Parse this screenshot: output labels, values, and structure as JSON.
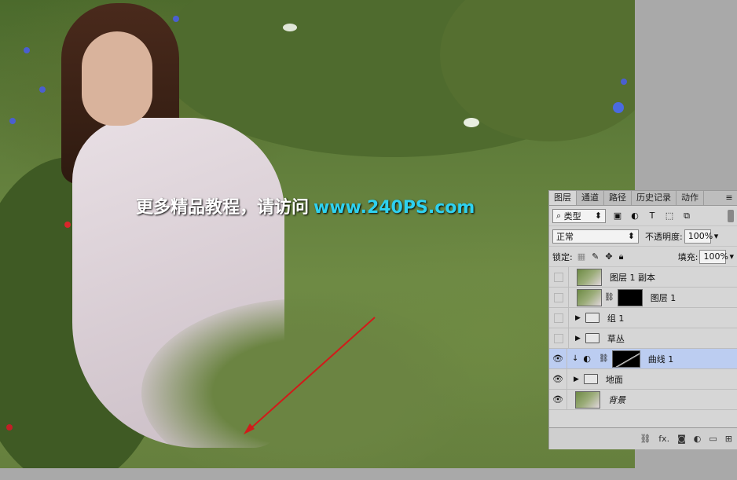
{
  "watermark": {
    "text": "更多精品教程，请访问",
    "url": "www.240PS.com"
  },
  "layers_panel": {
    "tabs": [
      "图层",
      "通道",
      "路径",
      "历史记录",
      "动作"
    ],
    "filter_kind": "类型",
    "blend_mode": "正常",
    "opacity_label": "不透明度:",
    "opacity_value": "100%",
    "lock_label": "锁定:",
    "fill_label": "填充:",
    "fill_value": "100%",
    "layers": [
      {
        "name": "图层 1 副本",
        "visible": false
      },
      {
        "name": "图层 1",
        "visible": false
      },
      {
        "name": "组 1",
        "visible": false
      },
      {
        "name": "草丛",
        "visible": false
      },
      {
        "name": "曲线 1",
        "visible": true,
        "selected": true
      },
      {
        "name": "地面",
        "visible": true
      },
      {
        "name": "背景",
        "visible": true
      }
    ],
    "bottom_icons": [
      "link-icon",
      "fx-icon",
      "mask-icon",
      "adjustment-icon",
      "folder-icon",
      "new-layer-icon"
    ],
    "fx_label": "fx."
  },
  "colors": {
    "selected_layer": "#bccdf1",
    "watermark_url": "#2ed1f0",
    "arrow": "#d21a1a"
  }
}
